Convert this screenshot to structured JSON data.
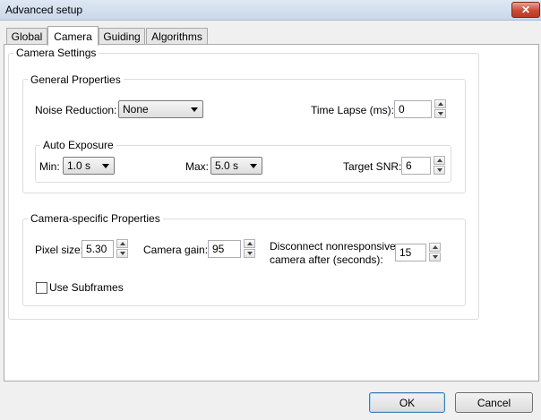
{
  "window": {
    "title": "Advanced setup",
    "close_glyph": "✕"
  },
  "tabs": [
    {
      "label": "Global"
    },
    {
      "label": "Camera"
    },
    {
      "label": "Guiding"
    },
    {
      "label": "Algorithms"
    }
  ],
  "active_tab": "Camera",
  "camera_settings": {
    "legend": "Camera Settings",
    "general": {
      "legend": "General Properties",
      "noise_reduction": {
        "label": "Noise Reduction:",
        "value": "None"
      },
      "time_lapse": {
        "label": "Time Lapse (ms):",
        "value": "0"
      },
      "auto_exposure": {
        "legend": "Auto Exposure",
        "min": {
          "label": "Min:",
          "value": "1.0 s"
        },
        "max": {
          "label": "Max:",
          "value": "5.0 s"
        },
        "target_snr": {
          "label": "Target SNR:",
          "value": "6"
        }
      }
    },
    "specific": {
      "legend": "Camera-specific Properties",
      "pixel_size": {
        "label": "Pixel size:",
        "value": "5.30"
      },
      "camera_gain": {
        "label": "Camera gain:",
        "value": "95"
      },
      "disconnect": {
        "label_line1": "Disconnect nonresponsive",
        "label_line2": "camera after (seconds):",
        "value": "15"
      },
      "use_subframes": {
        "label": "Use Subframes",
        "checked": false
      }
    }
  },
  "buttons": {
    "ok": "OK",
    "cancel": "Cancel"
  }
}
